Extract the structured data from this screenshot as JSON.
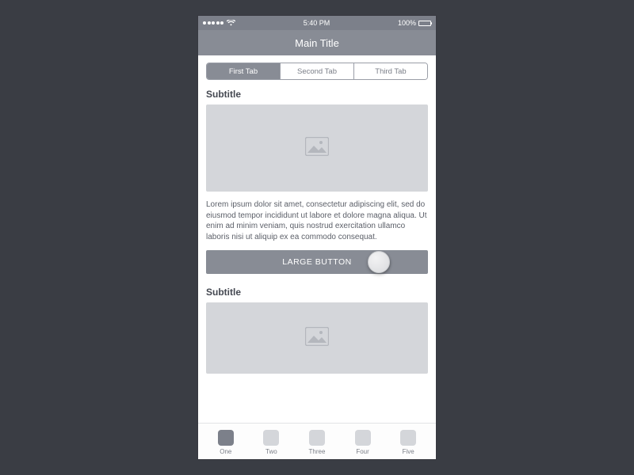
{
  "status": {
    "time": "5:40 PM",
    "battery_pct": "100%"
  },
  "nav": {
    "title": "Main Title"
  },
  "tabs": {
    "items": [
      {
        "label": "First Tab"
      },
      {
        "label": "Second Tab"
      },
      {
        "label": "Third Tab"
      }
    ],
    "active_index": 0
  },
  "sections": [
    {
      "subtitle": "Subtitle",
      "body": "Lorem ipsum dolor sit amet, consectetur adipiscing elit, sed do eiusmod tempor incididunt ut labore et dolore magna aliqua. Ut enim ad minim veniam, quis nostrud exercitation ullamco laboris nisi ut aliquip ex ea commodo consequat."
    },
    {
      "subtitle": "Subtitle"
    }
  ],
  "cta": {
    "label": "LARGE BUTTON"
  },
  "bottom_tabs": {
    "items": [
      {
        "label": "One"
      },
      {
        "label": "Two"
      },
      {
        "label": "Three"
      },
      {
        "label": "Four"
      },
      {
        "label": "Five"
      }
    ],
    "active_index": 0
  },
  "colors": {
    "chrome": "#888c95",
    "status": "#7c808a",
    "placeholder": "#d4d6da",
    "page_bg": "#3a3d44"
  }
}
